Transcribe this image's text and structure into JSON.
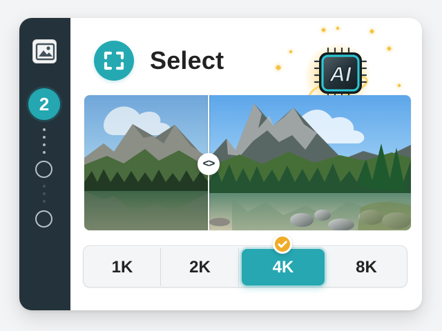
{
  "sidebar": {
    "active_step": "2"
  },
  "header": {
    "title": "Select"
  },
  "badge": {
    "label": "AI"
  },
  "resolution": {
    "options": [
      "1K",
      "2K",
      "4K",
      "8K"
    ],
    "selected": "4K"
  },
  "compare": {
    "handle_label": "<>"
  },
  "icons": {
    "image": "image-icon",
    "select": "select-icon",
    "ai": "ai-chip-icon",
    "check": "check-icon"
  },
  "colors": {
    "accent": "#24a9b2",
    "sidebar": "#24323b",
    "check": "#f0ac28"
  }
}
